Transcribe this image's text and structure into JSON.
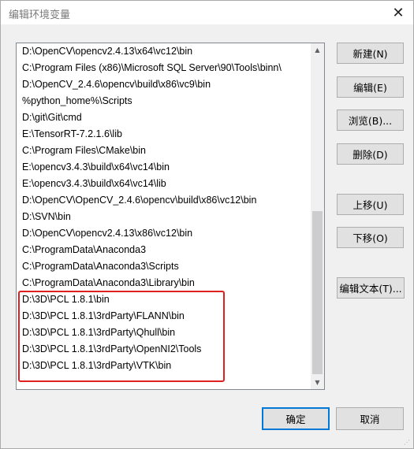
{
  "window": {
    "title": "编辑环境变量",
    "close_symbol": "✕"
  },
  "path_list": {
    "items": [
      "D:\\OpenCV\\opencv2.4.13\\x64\\vc12\\bin",
      "C:\\Program Files (x86)\\Microsoft SQL Server\\90\\Tools\\binn\\",
      "D:\\OpenCV_2.4.6\\opencv\\build\\x86\\vc9\\bin",
      "%python_home%\\Scripts",
      "D:\\git\\Git\\cmd",
      "E:\\TensorRT-7.2.1.6\\lib",
      "C:\\Program Files\\CMake\\bin",
      "E:\\opencv3.4.3\\build\\x64\\vc14\\bin",
      "E:\\opencv3.4.3\\build\\x64\\vc14\\lib",
      "D:\\OpenCV\\OpenCV_2.4.6\\opencv\\build\\x86\\vc12\\bin",
      "D:\\SVN\\bin",
      "D:\\OpenCV\\opencv2.4.13\\x86\\vc12\\bin",
      "C:\\ProgramData\\Anaconda3",
      "C:\\ProgramData\\Anaconda3\\Scripts",
      "C:\\ProgramData\\Anaconda3\\Library\\bin",
      "D:\\3D\\PCL 1.8.1\\bin",
      "D:\\3D\\PCL 1.8.1\\3rdParty\\FLANN\\bin",
      "D:\\3D\\PCL 1.8.1\\3rdParty\\Qhull\\bin",
      "D:\\3D\\PCL 1.8.1\\3rdParty\\OpenNI2\\Tools",
      "D:\\3D\\PCL 1.8.1\\3rdParty\\VTK\\bin"
    ],
    "scroll_up_symbol": "▲",
    "scroll_down_symbol": "▼"
  },
  "buttons": {
    "new": "新建(N)",
    "edit": "编辑(E)",
    "browse": "浏览(B)...",
    "delete": "删除(D)",
    "move_up": "上移(U)",
    "move_down": "下移(O)",
    "edit_text": "编辑文本(T)...",
    "ok": "确定",
    "cancel": "取消"
  },
  "colors": {
    "highlight_border": "#e0201e",
    "default_button_border": "#0078d7"
  }
}
